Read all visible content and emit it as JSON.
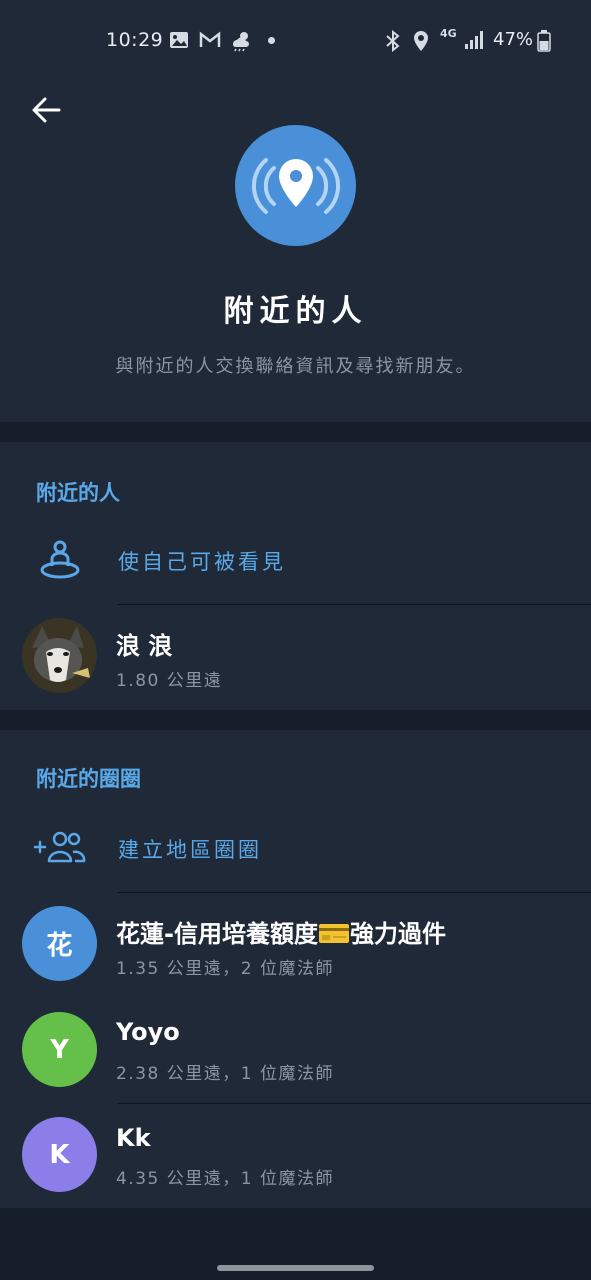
{
  "status_bar": {
    "time": "10:29",
    "network": "4G",
    "battery": "47%",
    "icons": [
      "image-icon",
      "gmail-icon",
      "weather-icon",
      "bluetooth-icon",
      "location-icon",
      "signal-icon",
      "battery-icon"
    ]
  },
  "header": {
    "title": "附近的人",
    "subtitle": "與附近的人交換聯絡資訊及尋找新朋友。"
  },
  "people_section": {
    "title": "附近的人",
    "make_visible_label": "使自己可被看見",
    "people": [
      {
        "name": "浪 浪",
        "distance": "1.80 公里遠"
      }
    ]
  },
  "groups_section": {
    "title": "附近的圈圈",
    "create_group_label": "建立地區圈圈",
    "groups": [
      {
        "initial": "花",
        "name_before": "花蓮-信用培養額度",
        "name_after": "強力過件",
        "meta": "1.35 公里遠，2 位魔法師",
        "color": "#4a90d9"
      },
      {
        "initial": "Y",
        "name": "Yoyo",
        "meta": "2.38 公里遠，1 位魔法師",
        "color": "#65c04a"
      },
      {
        "initial": "K",
        "name": "Kk",
        "meta": "4.35 公里遠，1 位魔法師",
        "color": "#8c7ee8"
      }
    ]
  },
  "colors": {
    "accent": "#5aa8e8",
    "background": "#161e29",
    "surface": "#1f2937"
  }
}
